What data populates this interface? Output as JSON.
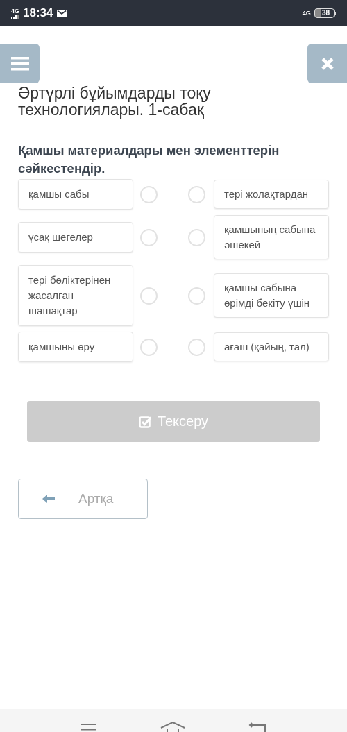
{
  "status_bar": {
    "network_left": "4G",
    "time": "18:34",
    "network_right": "4G",
    "battery": "38"
  },
  "title": "Әртүрлі бұйымдарды тоқу технологиялары. 1-сабақ",
  "question": "Қамшы материалдары мен элементтерін сәйкестендір.",
  "left_items": [
    {
      "text": "қамшы сабы",
      "selected": false
    },
    {
      "text": "ұсақ шегелер",
      "selected": false
    },
    {
      "text": "тері бөліктерінен жасалған шашақтар",
      "selected": false
    },
    {
      "text": "қамшыны өру",
      "selected": false
    }
  ],
  "right_items": [
    {
      "text": "тері жолақтардан",
      "selected": false
    },
    {
      "text": "қамшының сабына әшекей",
      "selected": false
    },
    {
      "text": "қамшы сабына өрімді бекіту үшін",
      "selected": false
    },
    {
      "text": "ағаш (қайың, тал)",
      "selected": false
    }
  ],
  "check_button": {
    "label": "Тексеру",
    "disabled": true
  },
  "back_button": {
    "label": "Артқа"
  }
}
